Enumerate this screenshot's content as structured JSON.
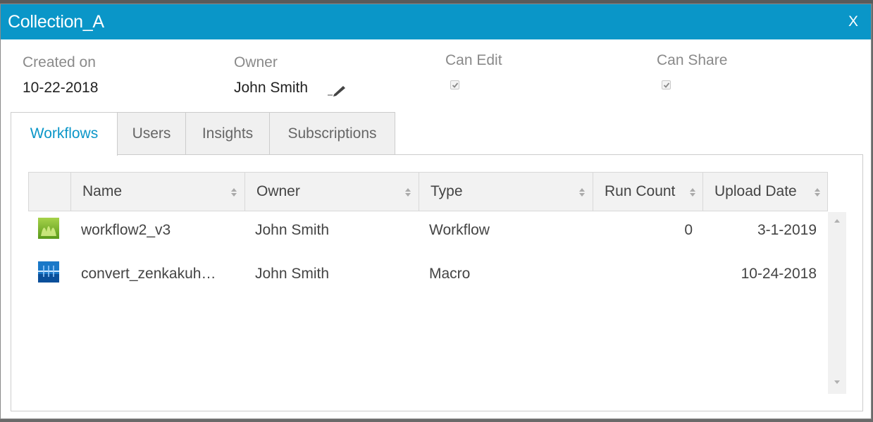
{
  "dialog": {
    "title": "Collection_A",
    "close_label": "X"
  },
  "meta": {
    "created_label": "Created on",
    "created_value": "10-22-2018",
    "owner_label": "Owner",
    "owner_value": "John Smith",
    "can_edit_label": "Can Edit",
    "can_edit_checked": true,
    "can_share_label": "Can Share",
    "can_share_checked": true
  },
  "tabs": [
    {
      "label": "Workflows",
      "active": true
    },
    {
      "label": "Users",
      "active": false
    },
    {
      "label": "Insights",
      "active": false
    },
    {
      "label": "Subscriptions",
      "active": false
    }
  ],
  "table": {
    "columns": [
      "Name",
      "Owner",
      "Type",
      "Run Count",
      "Upload Date"
    ],
    "rows": [
      {
        "icon": "workflow-icon",
        "name": "workflow2_v3",
        "owner": "John Smith",
        "type": "Workflow",
        "run_count": "0",
        "upload_date": "3-1-2019"
      },
      {
        "icon": "macro-icon",
        "name": "convert_zenkakuh…",
        "owner": "John Smith",
        "type": "Macro",
        "run_count": "",
        "upload_date": "10-24-2018"
      }
    ]
  },
  "colors": {
    "title_bar": "#0a96c8",
    "active_tab": "#0a96c8"
  }
}
